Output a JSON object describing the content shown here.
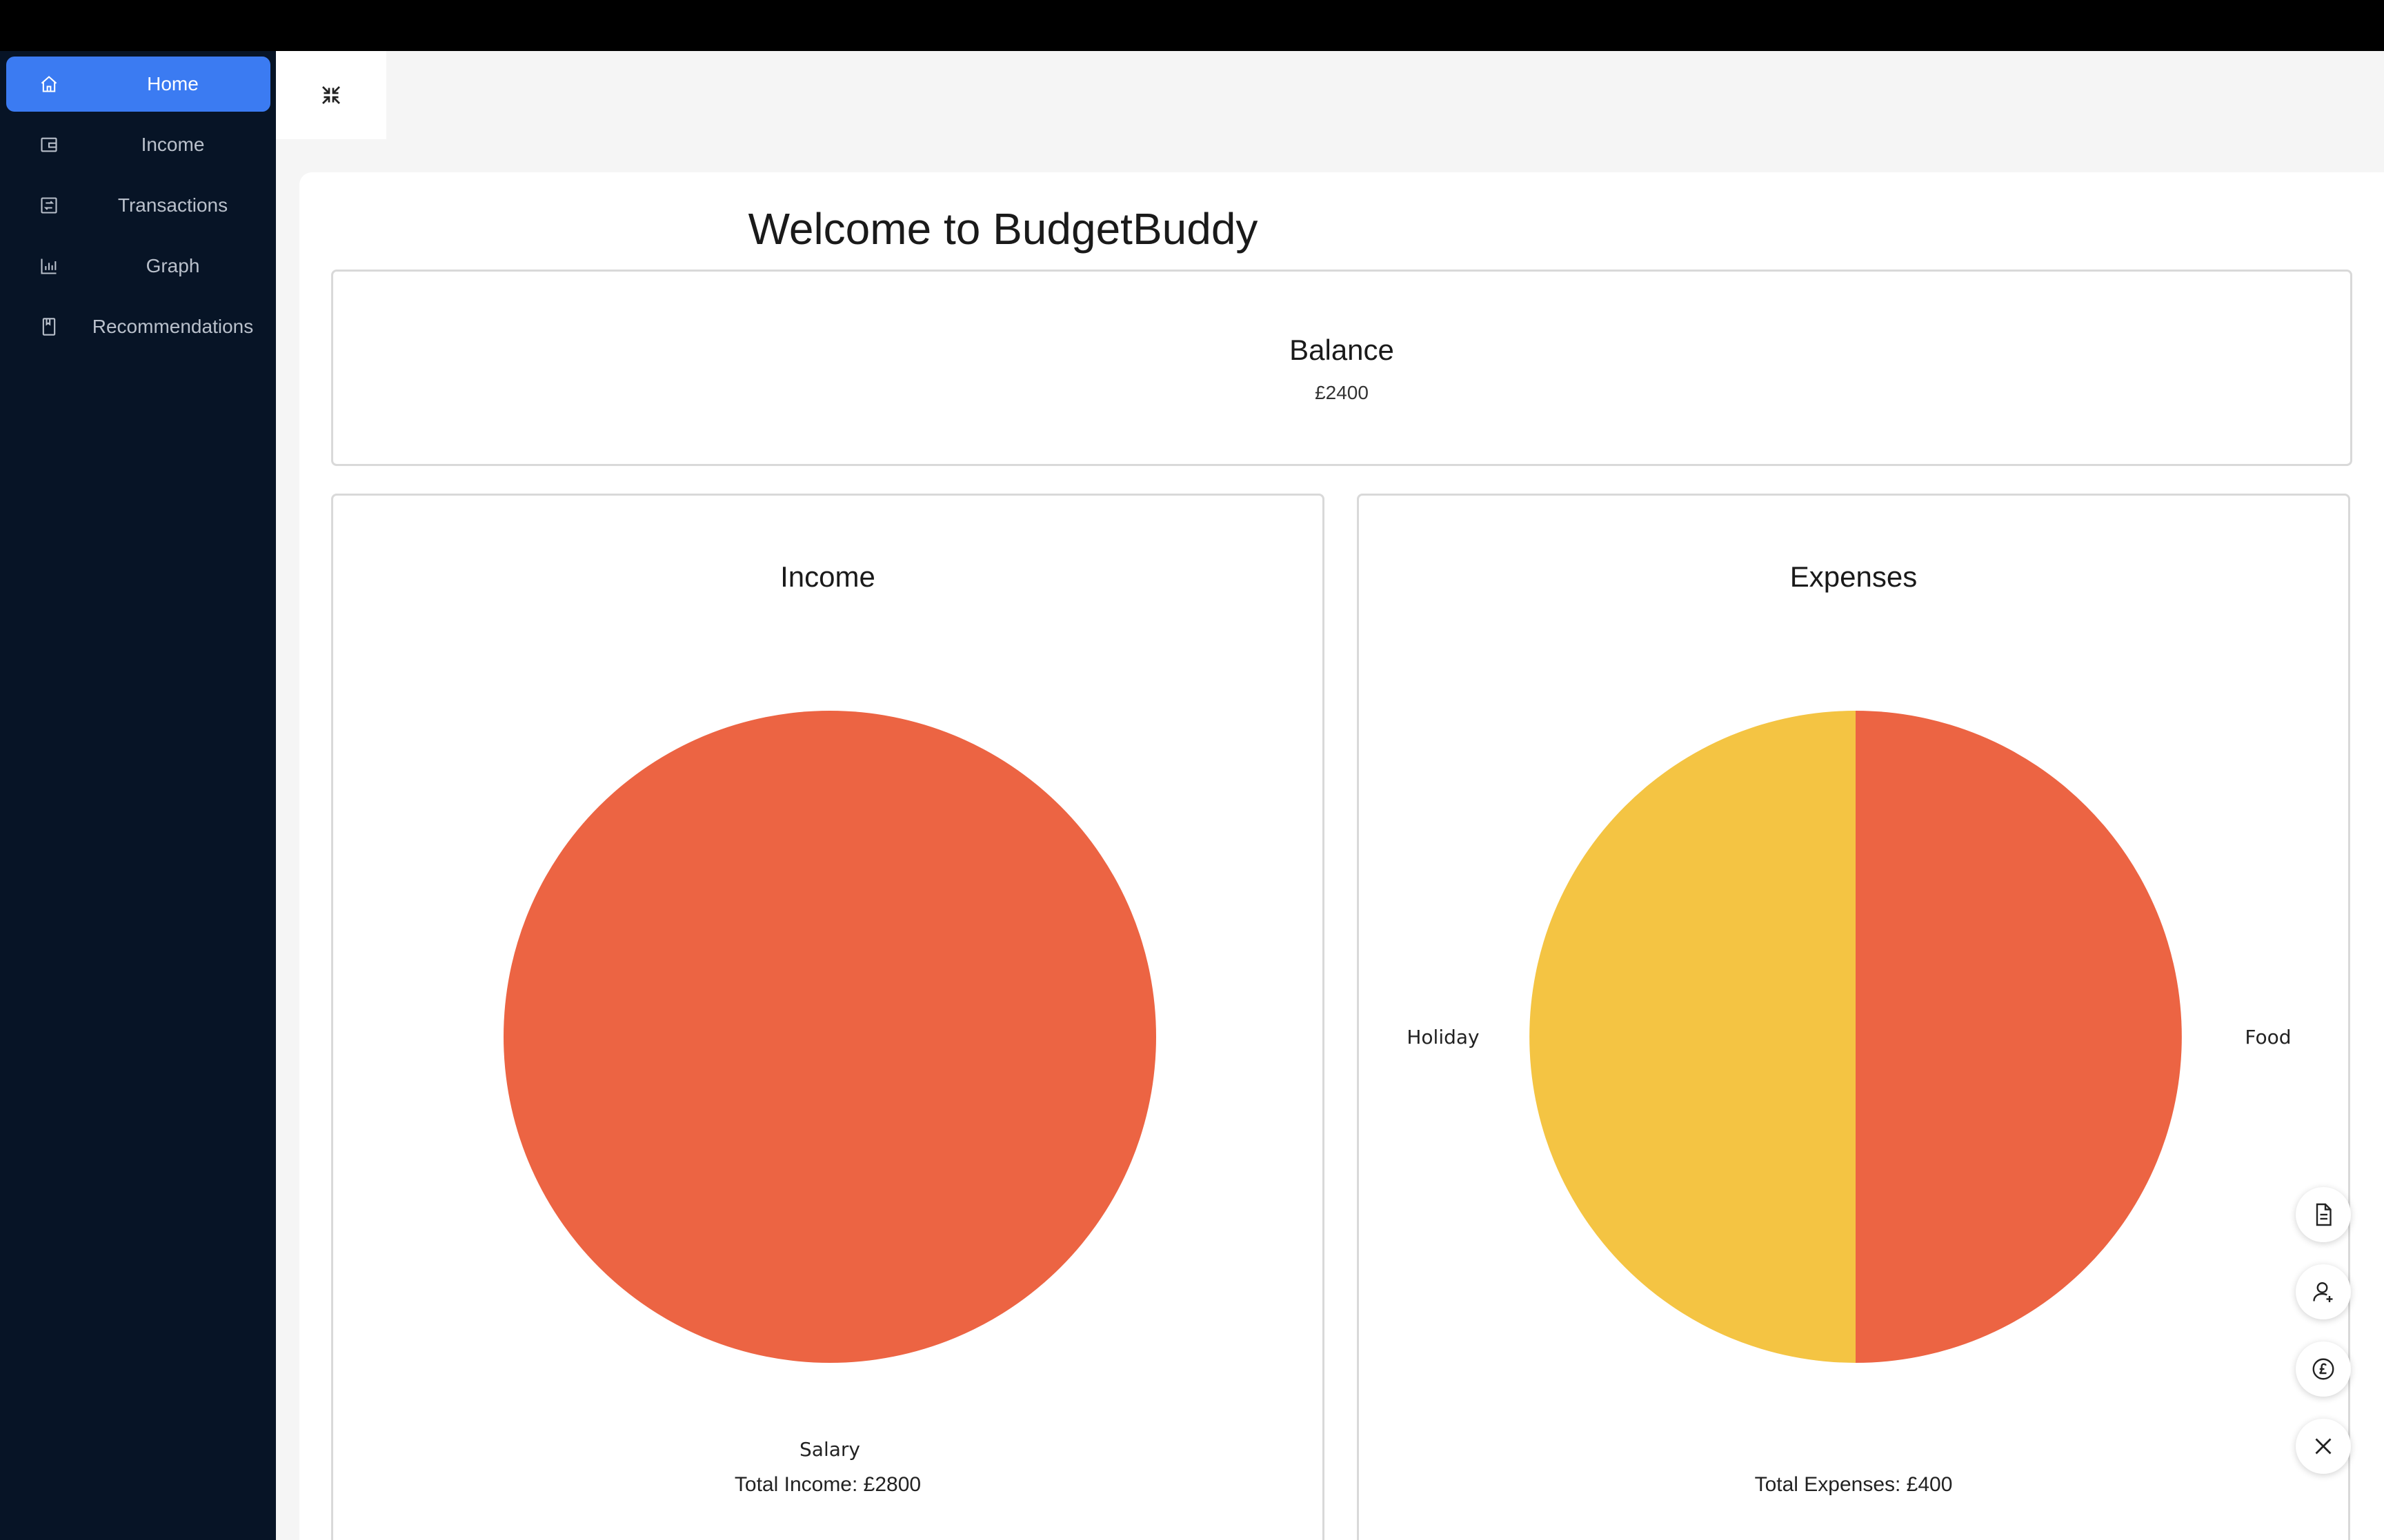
{
  "sidebar": {
    "items": [
      {
        "label": "Home",
        "icon": "home-icon",
        "active": true
      },
      {
        "label": "Income",
        "icon": "wallet-icon",
        "active": false
      },
      {
        "label": "Transactions",
        "icon": "transactions-icon",
        "active": false
      },
      {
        "label": "Graph",
        "icon": "bar-chart-icon",
        "active": false
      },
      {
        "label": "Recommendations",
        "icon": "book-icon",
        "active": false
      }
    ]
  },
  "header": {
    "collapse_icon": "collapse-icon"
  },
  "main": {
    "title": "Welcome to BudgetBuddy",
    "balance": {
      "title": "Balance",
      "value": "£2400"
    },
    "income": {
      "title": "Income",
      "total": "Total Income: £2800"
    },
    "expenses": {
      "title": "Expenses",
      "total": "Total Expenses: £400"
    }
  },
  "chart_data": [
    {
      "type": "pie",
      "title": "Income",
      "categories": [
        "Salary"
      ],
      "values": [
        2800
      ],
      "colors": [
        "#ec6443"
      ]
    },
    {
      "type": "pie",
      "title": "Expenses",
      "categories": [
        "Food",
        "Holiday"
      ],
      "values": [
        200,
        200
      ],
      "colors": [
        "#ec6443",
        "#f4c443"
      ]
    }
  ],
  "fabs": [
    {
      "icon": "document-icon"
    },
    {
      "icon": "add-user-icon"
    },
    {
      "icon": "pound-coin-icon"
    },
    {
      "icon": "close-icon"
    }
  ],
  "colors": {
    "sidebar_bg": "#071426",
    "accent": "#3b7bf2",
    "pie_red": "#ec6443",
    "pie_yellow": "#f4c443"
  }
}
